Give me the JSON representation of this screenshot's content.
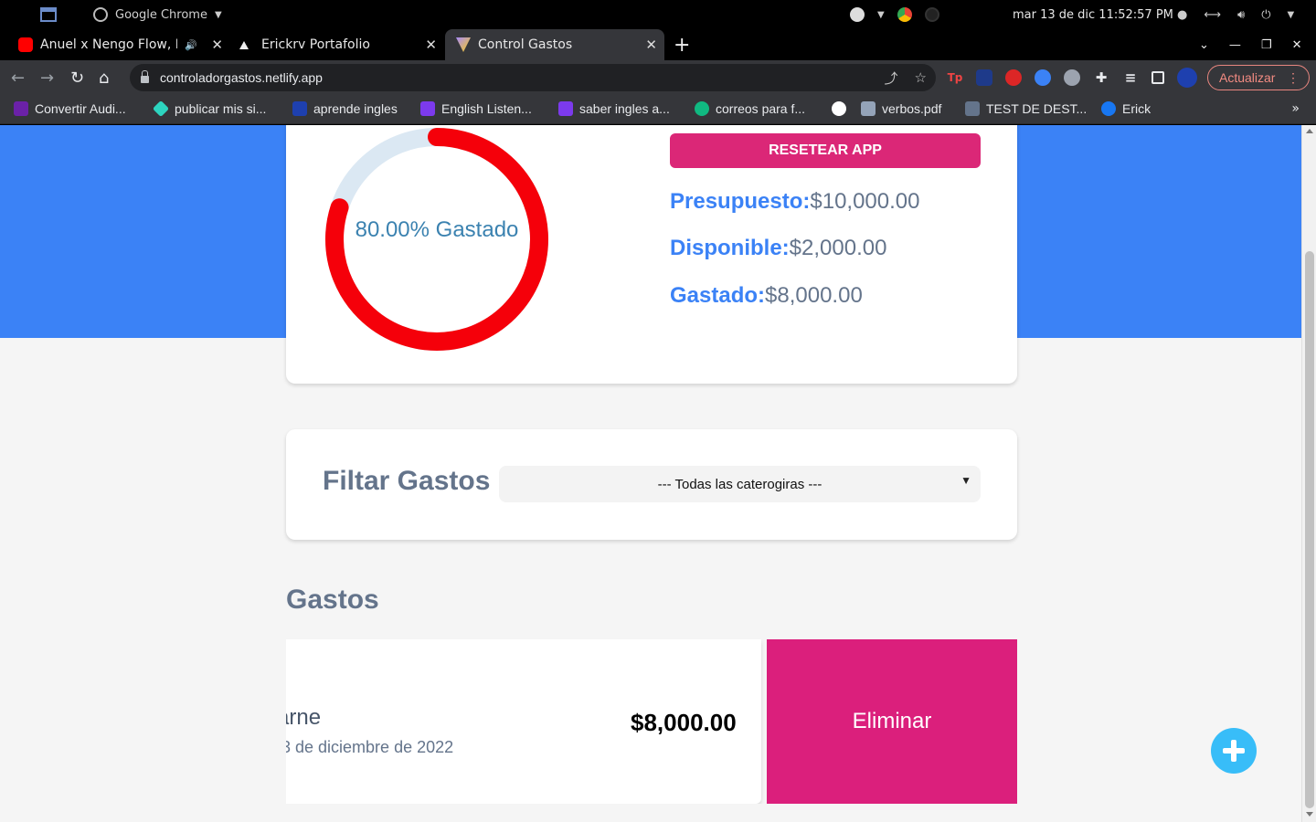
{
  "os": {
    "app_name": "Google Chrome",
    "clock": "mar 13 de dic  11:52:57 PM"
  },
  "tabs": [
    {
      "title": "Anuel x Nengo Flow, L",
      "audio": "🔊"
    },
    {
      "title": "Erickrv Portafolio"
    },
    {
      "title": "Control Gastos"
    }
  ],
  "toolbar": {
    "url": "controladorgastos.netlify.app",
    "update_label": "Actualizar",
    "ext_tp": "Tp"
  },
  "bookmarks": [
    {
      "label": "Convertir Audi...",
      "color": "#6b21a8"
    },
    {
      "label": "publicar mis si...",
      "color": "#2dd4bf"
    },
    {
      "label": "aprende ingles",
      "color": "#1e40af"
    },
    {
      "label": "English Listen...",
      "color": "#7c3aed"
    },
    {
      "label": "saber ingles a...",
      "color": "#7c3aed"
    },
    {
      "label": "correos para f...",
      "color": "#10b981"
    },
    {
      "label": "",
      "color": "#ffffff"
    },
    {
      "label": "verbos.pdf",
      "color": "#94a3b8"
    },
    {
      "label": "TEST DE DEST...",
      "color": "#64748b"
    },
    {
      "label": "Erick",
      "color": "#1877f2"
    }
  ],
  "budget": {
    "percent_label": "80.00% Gastado",
    "spent_fraction": 0.8,
    "reset_label": "RESETEAR APP",
    "presupuesto_label": "Presupuesto:",
    "presupuesto_value": "$10,000.00",
    "disponible_label": "Disponible:",
    "disponible_value": "$2,000.00",
    "gastado_label": "Gastado:",
    "gastado_value": "$8,000.00"
  },
  "filter": {
    "label": "Filtar Gastos",
    "selected": "--- Todas las caterogiras ---"
  },
  "gastos": {
    "title": "Gastos",
    "items": [
      {
        "name": "arne",
        "date": ".3 de diciembre de 2022",
        "amount": "$8,000.00",
        "delete_label": "Eliminar"
      }
    ]
  },
  "colors": {
    "hero_blue": "#3b82f6",
    "accent_pink": "#db2777",
    "donut_red": "#f5000a",
    "donut_track": "#dbe8f3",
    "fab": "#38bdf8"
  }
}
